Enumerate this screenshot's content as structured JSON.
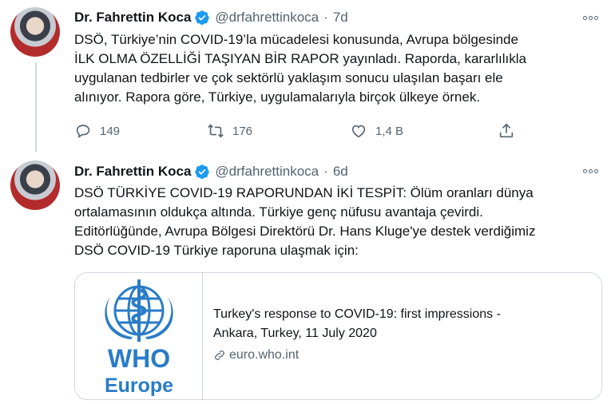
{
  "tweets": [
    {
      "author": "Dr. Fahrettin Koca",
      "handle": "@drfahrettinkoca",
      "separator": "·",
      "time": "7d",
      "lines": [
        "DSÖ, Türkiye’nin COVID-19’la  mücadelesi konusunda, Avrupa bölgesinde",
        "İLK OLMA ÖZELLİĞİ TAŞIYAN BİR RAPOR yayınladı. Raporda, kararlılıkla",
        "uygulanan tedbirler ve çok sektörlü yaklaşım sonucu ulaşılan başarı ele",
        "alınıyor. Rapora göre, Türkiye, uygulamalarıyla birçok ülkeye örnek."
      ],
      "replies": "149",
      "retweets": "176",
      "likes": "1,4 B"
    },
    {
      "author": "Dr. Fahrettin Koca",
      "handle": "@drfahrettinkoca",
      "separator": "·",
      "time": "6d",
      "lines": [
        "DSÖ TÜRKİYE COVID-19 RAPORUNDAN İKİ TESPİT: Ölüm oranları dünya",
        "ortalamasının oldukça altında. Türkiye genç nüfusu avantaja çevirdi.",
        "Editörlüğünde, Avrupa Bölgesi Direktörü Dr. Hans Kluge'ye destek verdiğimiz",
        "DSÖ COVID-19 Türkiye raporuna ulaşmak için:"
      ],
      "card": {
        "title_line1": "Turkey's response to COVID-19: first impressions -",
        "title_line2": "Ankara, Turkey, 11 July 2020",
        "domain": "euro.who.int",
        "logo_line1": "WHO",
        "logo_line2": "Europe"
      }
    }
  ],
  "colors": {
    "verified": "#1d9bf0",
    "secondary_text": "#536471",
    "who_blue": "#2a7cc7"
  },
  "icons": [
    "verified-badge-icon",
    "more-options-icon",
    "reply-icon",
    "retweet-icon",
    "like-icon",
    "share-icon",
    "link-icon",
    "who-emblem-icon"
  ]
}
